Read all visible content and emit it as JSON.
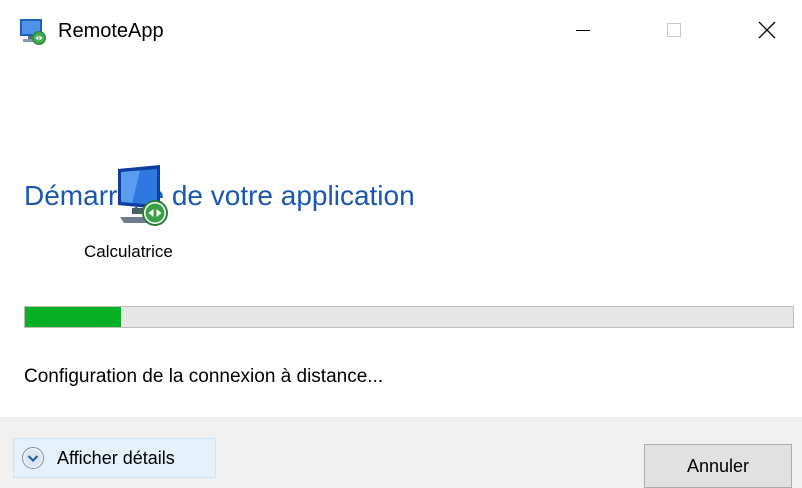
{
  "window": {
    "title": "RemoteApp"
  },
  "main": {
    "heading": "Démarrage de votre application",
    "app_name": "Calculatrice",
    "progress": 0.125,
    "status": "Configuration de la connexion à distance..."
  },
  "footer": {
    "details_label": "Afficher détails",
    "cancel_label": "Annuler"
  },
  "colors": {
    "heading": "#1a57b0",
    "progress_fill": "#06b025",
    "progress_track": "#e6e6e6",
    "footer_bg": "#f0f0f0"
  },
  "icons": {
    "app": "remoteapp-icon",
    "app_large": "remote-computer-icon",
    "details": "chevron-down-circle-icon",
    "minimize": "minimize-icon",
    "maximize": "maximize-icon",
    "close": "close-icon"
  }
}
